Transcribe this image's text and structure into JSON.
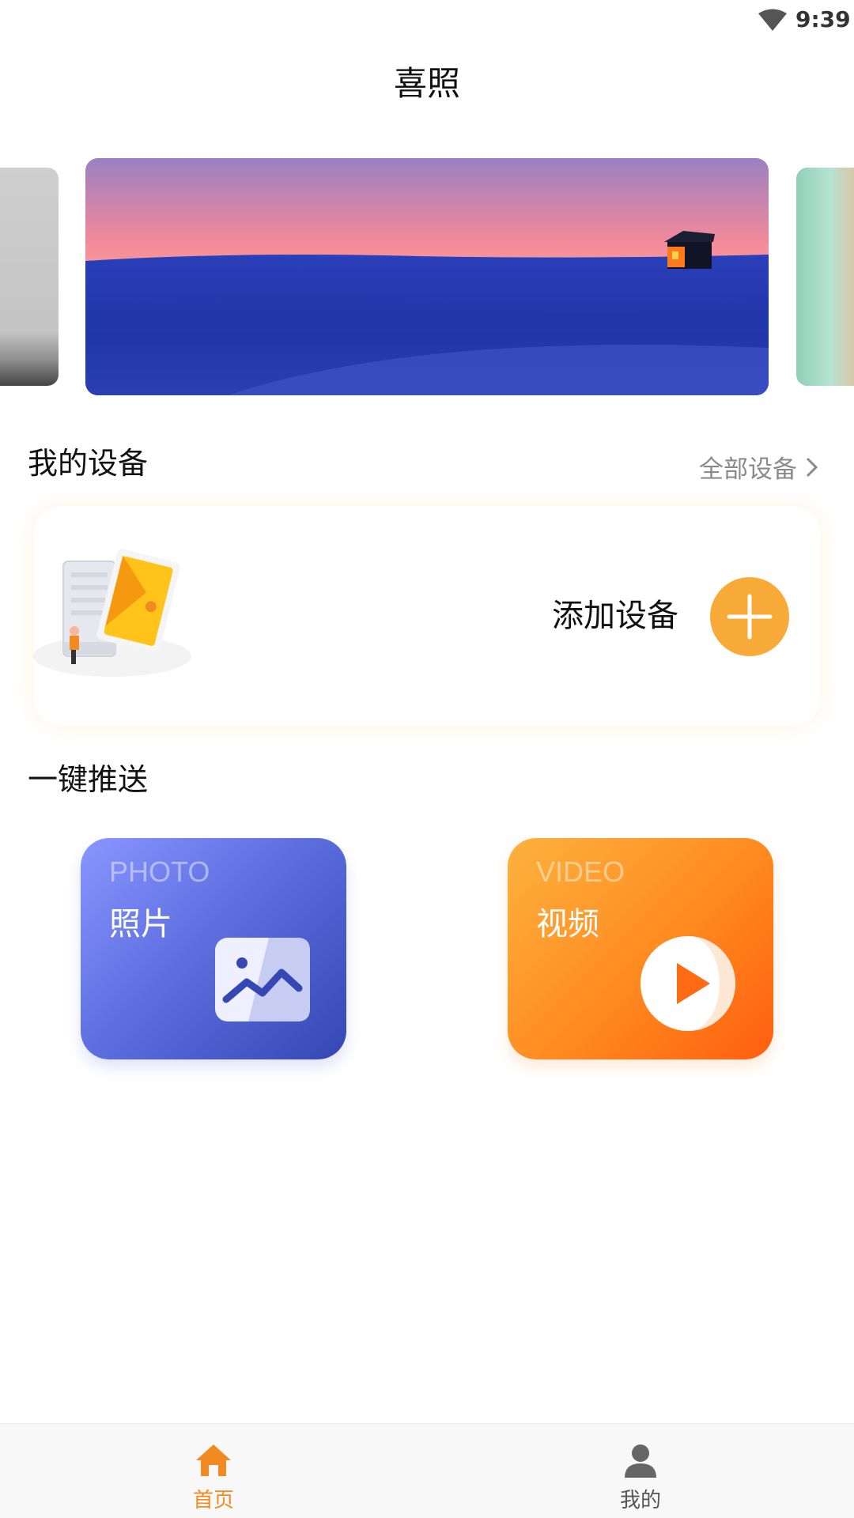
{
  "status_bar": {
    "time": "9:39",
    "wifi_icon": "wifi-icon"
  },
  "header": {
    "title": "喜照"
  },
  "banner": {
    "slides": [
      "gray-landscape",
      "snow-dusk-cabin",
      "green-pastel"
    ],
    "active_index": 1
  },
  "my_devices": {
    "heading": "我的设备",
    "all_devices_link": "全部设备",
    "add_device_label": "添加设备",
    "add_icon": "plus-icon",
    "accent": "#f8aa38"
  },
  "one_key_push": {
    "heading": "一键推送",
    "tiles": [
      {
        "en": "PHOTO",
        "cn": "照片",
        "icon": "image-icon",
        "color": "#5e6fe0"
      },
      {
        "en": "VIDEO",
        "cn": "视频",
        "icon": "play-icon",
        "color": "#ff8a20"
      }
    ]
  },
  "bottom_nav": {
    "items": [
      {
        "label": "首页",
        "icon": "home-icon",
        "active": true
      },
      {
        "label": "我的",
        "icon": "user-icon",
        "active": false
      }
    ],
    "active_color": "#f28a22"
  }
}
